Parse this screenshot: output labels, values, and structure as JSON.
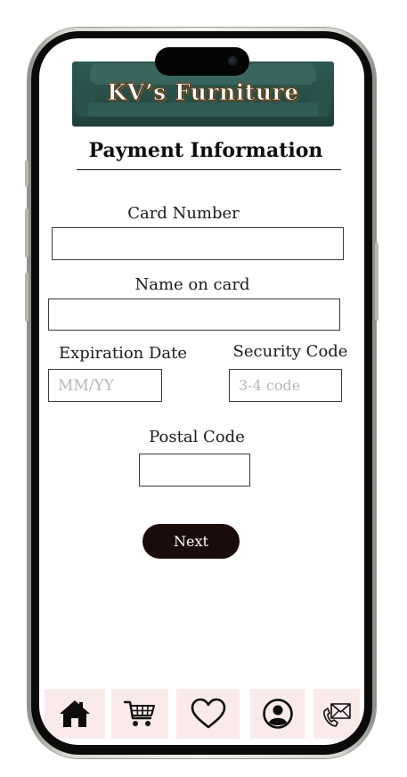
{
  "app": {
    "brand_title": "KV’s Furniture"
  },
  "page": {
    "title": "Payment Information"
  },
  "form": {
    "card_number": {
      "label": "Card Number",
      "value": "",
      "placeholder": ""
    },
    "name_on_card": {
      "label": "Name on card",
      "value": "",
      "placeholder": ""
    },
    "expiration_date": {
      "label": "Expiration Date",
      "value": "",
      "placeholder": "MM/YY"
    },
    "security_code": {
      "label": "Security Code",
      "value": "",
      "placeholder": "3-4 code"
    },
    "postal_code": {
      "label": "Postal Code",
      "value": "",
      "placeholder": ""
    },
    "next_label": "Next"
  },
  "navbar": {
    "items": [
      {
        "icon": "home-icon"
      },
      {
        "icon": "shopping-cart-icon"
      },
      {
        "icon": "heart-icon"
      },
      {
        "icon": "user-profile-icon"
      },
      {
        "icon": "contact-mail-phone-icon"
      }
    ]
  },
  "colors": {
    "nav_background": "#fbeaea",
    "button_background": "#1a0c0a",
    "banner_green": "#2d5a54"
  }
}
